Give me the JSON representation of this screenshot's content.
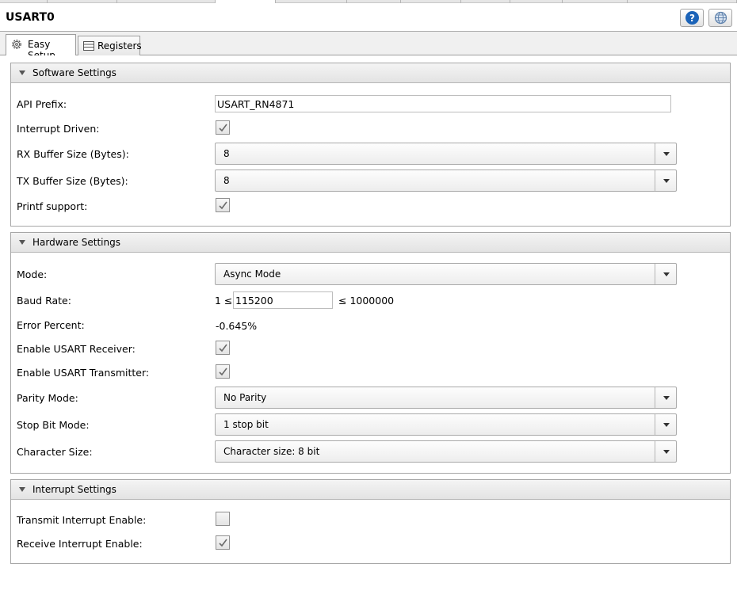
{
  "window": {
    "title": "USART0"
  },
  "header_buttons": {
    "help_icon": "help-icon",
    "globe_icon": "globe-icon",
    "help_color": "#1b63b8"
  },
  "tabs": [
    {
      "label": "Easy Setup",
      "icon": "gear-icon",
      "active": true
    },
    {
      "label": "Registers",
      "icon": "registers-icon",
      "active": false
    }
  ],
  "software": {
    "title": "Software Settings",
    "api_prefix": {
      "label": "API Prefix:",
      "value": "USART_RN4871"
    },
    "interrupt_driven": {
      "label": "Interrupt Driven:",
      "checked": true
    },
    "rx_buffer": {
      "label": "RX Buffer Size (Bytes):",
      "value": "8"
    },
    "tx_buffer": {
      "label": "TX Buffer Size (Bytes):",
      "value": "8"
    },
    "printf": {
      "label": "Printf support:",
      "checked": true
    }
  },
  "hardware": {
    "title": "Hardware Settings",
    "mode": {
      "label": "Mode:",
      "value": "Async Mode"
    },
    "baud": {
      "label": "Baud Rate:",
      "min": "1 ≤",
      "value": "115200",
      "max": "≤ 1000000"
    },
    "error": {
      "label": "Error Percent:",
      "value": "-0.645%"
    },
    "rx_enable": {
      "label": "Enable USART Receiver:",
      "checked": true
    },
    "tx_enable": {
      "label": "Enable USART Transmitter:",
      "checked": true
    },
    "parity": {
      "label": "Parity Mode:",
      "value": "No Parity"
    },
    "stop_bit": {
      "label": "Stop Bit Mode:",
      "value": "1 stop bit"
    },
    "char_size": {
      "label": "Character Size:",
      "value": "Character size: 8 bit"
    }
  },
  "interrupts": {
    "title": "Interrupt Settings",
    "tx_int": {
      "label": "Transmit Interrupt Enable:",
      "checked": false
    },
    "rx_int": {
      "label": "Receive Interrupt Enable:",
      "checked": true
    }
  }
}
